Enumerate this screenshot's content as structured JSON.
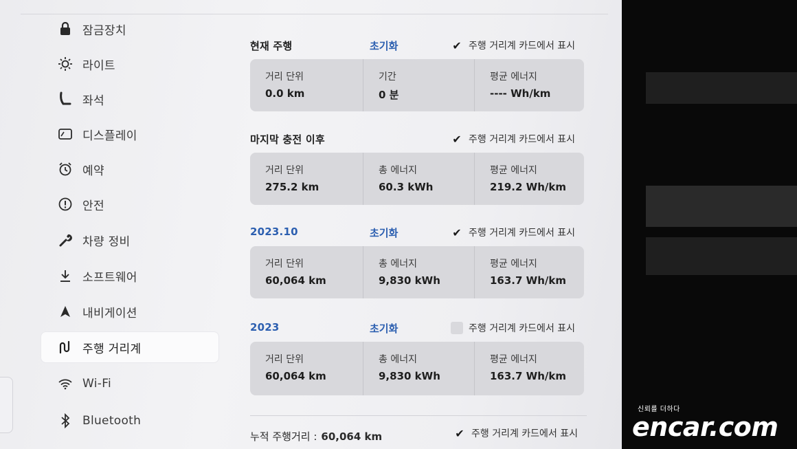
{
  "sidebar": {
    "items": [
      {
        "label": "잠금장치",
        "icon": "lock-icon"
      },
      {
        "label": "라이트",
        "icon": "sun-icon"
      },
      {
        "label": "좌석",
        "icon": "seat-icon"
      },
      {
        "label": "디스플레이",
        "icon": "display-icon"
      },
      {
        "label": "예약",
        "icon": "alarm-clock-icon"
      },
      {
        "label": "안전",
        "icon": "alert-circle-icon"
      },
      {
        "label": "차량 정비",
        "icon": "wrench-icon"
      },
      {
        "label": "소프트웨어",
        "icon": "download-icon"
      },
      {
        "label": "내비게이션",
        "icon": "navigation-arrow-icon"
      },
      {
        "label": "주행 거리계",
        "icon": "trip-route-icon",
        "active": true
      },
      {
        "label": "Wi-Fi",
        "icon": "wifi-icon"
      },
      {
        "label": "Bluetooth",
        "icon": "bluetooth-icon"
      }
    ]
  },
  "sections": [
    {
      "title": "현재 주행",
      "reset": "초기화",
      "toggle": "주행 거리계 카드에서 표시",
      "checked": true,
      "stats": [
        {
          "label": "거리 단위",
          "value": "0.0 km"
        },
        {
          "label": "기간",
          "value": "0 분"
        },
        {
          "label": "평균 에너지",
          "value": "---- Wh/km"
        }
      ]
    },
    {
      "title": "마지막 충전 이후",
      "reset": "",
      "toggle": "주행 거리계 카드에서 표시",
      "checked": true,
      "stats": [
        {
          "label": "거리 단위",
          "value": "275.2 km"
        },
        {
          "label": "총 에너지",
          "value": "60.3 kWh"
        },
        {
          "label": "평균 에너지",
          "value": "219.2 Wh/km"
        }
      ]
    },
    {
      "title": "2023.10",
      "reset": "초기화",
      "toggle": "주행 거리계 카드에서 표시",
      "checked": true,
      "stats": [
        {
          "label": "거리 단위",
          "value": "60,064 km"
        },
        {
          "label": "총 에너지",
          "value": "9,830 kWh"
        },
        {
          "label": "평균 에너지",
          "value": "163.7 Wh/km"
        }
      ]
    },
    {
      "title": "2023",
      "reset": "초기화",
      "toggle": "주행 거리계 카드에서 표시",
      "checked": false,
      "stats": [
        {
          "label": "거리 단위",
          "value": "60,064 km"
        },
        {
          "label": "총 에너지",
          "value": "9,830 kWh"
        },
        {
          "label": "평균 에너지",
          "value": "163.7 Wh/km"
        }
      ]
    }
  ],
  "total": {
    "label": "누적 주행거리 :",
    "value": "60,064 km",
    "toggle": "주행 거리계 카드에서 표시",
    "checked": true
  },
  "checkmark": "✔",
  "watermark": {
    "tagline": "신뢰를 더하다",
    "brand": "encar.com"
  },
  "colors": {
    "accent": "#2c5fb0",
    "card": "#d8d8dc",
    "panel": "#f0f0f3"
  }
}
